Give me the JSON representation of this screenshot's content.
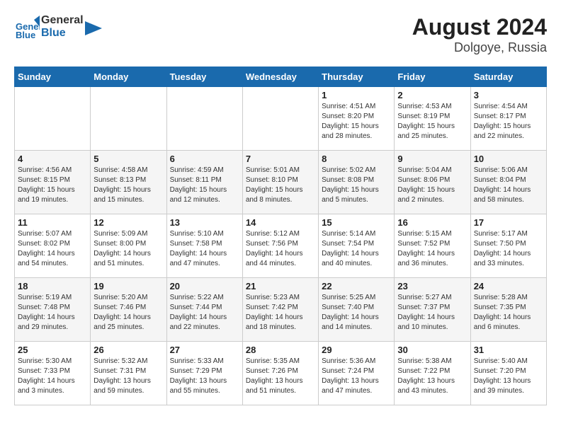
{
  "header": {
    "logo_line1": "General",
    "logo_line2": "Blue",
    "title": "August 2024",
    "subtitle": "Dolgoye, Russia"
  },
  "weekdays": [
    "Sunday",
    "Monday",
    "Tuesday",
    "Wednesday",
    "Thursday",
    "Friday",
    "Saturday"
  ],
  "weeks": [
    [
      {
        "day": "",
        "info": ""
      },
      {
        "day": "",
        "info": ""
      },
      {
        "day": "",
        "info": ""
      },
      {
        "day": "",
        "info": ""
      },
      {
        "day": "1",
        "info": "Sunrise: 4:51 AM\nSunset: 8:20 PM\nDaylight: 15 hours\nand 28 minutes."
      },
      {
        "day": "2",
        "info": "Sunrise: 4:53 AM\nSunset: 8:19 PM\nDaylight: 15 hours\nand 25 minutes."
      },
      {
        "day": "3",
        "info": "Sunrise: 4:54 AM\nSunset: 8:17 PM\nDaylight: 15 hours\nand 22 minutes."
      }
    ],
    [
      {
        "day": "4",
        "info": "Sunrise: 4:56 AM\nSunset: 8:15 PM\nDaylight: 15 hours\nand 19 minutes."
      },
      {
        "day": "5",
        "info": "Sunrise: 4:58 AM\nSunset: 8:13 PM\nDaylight: 15 hours\nand 15 minutes."
      },
      {
        "day": "6",
        "info": "Sunrise: 4:59 AM\nSunset: 8:11 PM\nDaylight: 15 hours\nand 12 minutes."
      },
      {
        "day": "7",
        "info": "Sunrise: 5:01 AM\nSunset: 8:10 PM\nDaylight: 15 hours\nand 8 minutes."
      },
      {
        "day": "8",
        "info": "Sunrise: 5:02 AM\nSunset: 8:08 PM\nDaylight: 15 hours\nand 5 minutes."
      },
      {
        "day": "9",
        "info": "Sunrise: 5:04 AM\nSunset: 8:06 PM\nDaylight: 15 hours\nand 2 minutes."
      },
      {
        "day": "10",
        "info": "Sunrise: 5:06 AM\nSunset: 8:04 PM\nDaylight: 14 hours\nand 58 minutes."
      }
    ],
    [
      {
        "day": "11",
        "info": "Sunrise: 5:07 AM\nSunset: 8:02 PM\nDaylight: 14 hours\nand 54 minutes."
      },
      {
        "day": "12",
        "info": "Sunrise: 5:09 AM\nSunset: 8:00 PM\nDaylight: 14 hours\nand 51 minutes."
      },
      {
        "day": "13",
        "info": "Sunrise: 5:10 AM\nSunset: 7:58 PM\nDaylight: 14 hours\nand 47 minutes."
      },
      {
        "day": "14",
        "info": "Sunrise: 5:12 AM\nSunset: 7:56 PM\nDaylight: 14 hours\nand 44 minutes."
      },
      {
        "day": "15",
        "info": "Sunrise: 5:14 AM\nSunset: 7:54 PM\nDaylight: 14 hours\nand 40 minutes."
      },
      {
        "day": "16",
        "info": "Sunrise: 5:15 AM\nSunset: 7:52 PM\nDaylight: 14 hours\nand 36 minutes."
      },
      {
        "day": "17",
        "info": "Sunrise: 5:17 AM\nSunset: 7:50 PM\nDaylight: 14 hours\nand 33 minutes."
      }
    ],
    [
      {
        "day": "18",
        "info": "Sunrise: 5:19 AM\nSunset: 7:48 PM\nDaylight: 14 hours\nand 29 minutes."
      },
      {
        "day": "19",
        "info": "Sunrise: 5:20 AM\nSunset: 7:46 PM\nDaylight: 14 hours\nand 25 minutes."
      },
      {
        "day": "20",
        "info": "Sunrise: 5:22 AM\nSunset: 7:44 PM\nDaylight: 14 hours\nand 22 minutes."
      },
      {
        "day": "21",
        "info": "Sunrise: 5:23 AM\nSunset: 7:42 PM\nDaylight: 14 hours\nand 18 minutes."
      },
      {
        "day": "22",
        "info": "Sunrise: 5:25 AM\nSunset: 7:40 PM\nDaylight: 14 hours\nand 14 minutes."
      },
      {
        "day": "23",
        "info": "Sunrise: 5:27 AM\nSunset: 7:37 PM\nDaylight: 14 hours\nand 10 minutes."
      },
      {
        "day": "24",
        "info": "Sunrise: 5:28 AM\nSunset: 7:35 PM\nDaylight: 14 hours\nand 6 minutes."
      }
    ],
    [
      {
        "day": "25",
        "info": "Sunrise: 5:30 AM\nSunset: 7:33 PM\nDaylight: 14 hours\nand 3 minutes."
      },
      {
        "day": "26",
        "info": "Sunrise: 5:32 AM\nSunset: 7:31 PM\nDaylight: 13 hours\nand 59 minutes."
      },
      {
        "day": "27",
        "info": "Sunrise: 5:33 AM\nSunset: 7:29 PM\nDaylight: 13 hours\nand 55 minutes."
      },
      {
        "day": "28",
        "info": "Sunrise: 5:35 AM\nSunset: 7:26 PM\nDaylight: 13 hours\nand 51 minutes."
      },
      {
        "day": "29",
        "info": "Sunrise: 5:36 AM\nSunset: 7:24 PM\nDaylight: 13 hours\nand 47 minutes."
      },
      {
        "day": "30",
        "info": "Sunrise: 5:38 AM\nSunset: 7:22 PM\nDaylight: 13 hours\nand 43 minutes."
      },
      {
        "day": "31",
        "info": "Sunrise: 5:40 AM\nSunset: 7:20 PM\nDaylight: 13 hours\nand 39 minutes."
      }
    ]
  ]
}
